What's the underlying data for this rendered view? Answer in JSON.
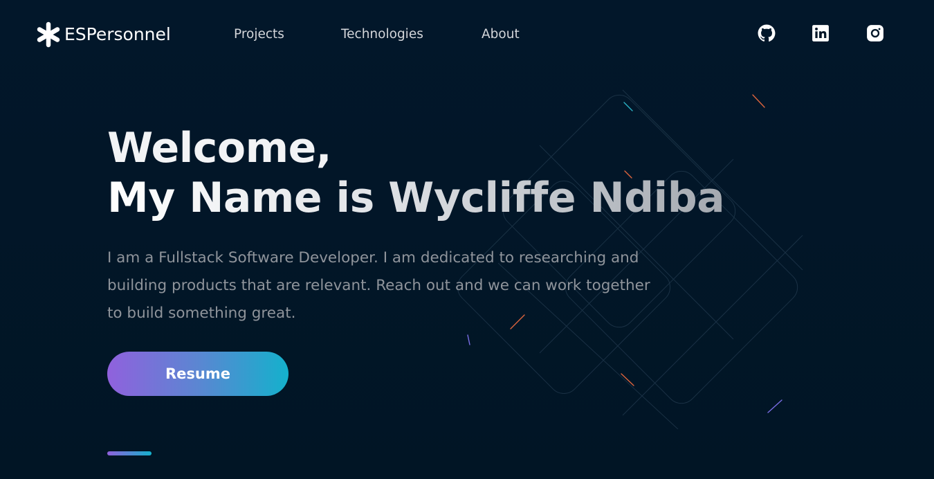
{
  "brand": {
    "name": "ESPersonnel",
    "icon": "asterisk-icon"
  },
  "nav": {
    "links": [
      {
        "label": "Projects"
      },
      {
        "label": "Technologies"
      },
      {
        "label": "About"
      }
    ]
  },
  "social": {
    "icons": [
      "github-icon",
      "linkedin-icon",
      "instagram-icon"
    ]
  },
  "hero": {
    "title_line1": "Welcome,",
    "title_line2": "My Name is Wycliffe Ndiba",
    "description": "I am a Fullstack Software Developer. I am dedicated to researching and building products that are relevant. Reach out and we can work together to build something great.",
    "resume_label": "Resume"
  },
  "colors": {
    "background": "#011627",
    "gradient_start": "#9061dd",
    "gradient_end": "#14b1cc",
    "nav_text": "#d4d6da",
    "body_text": "#8f949b"
  }
}
